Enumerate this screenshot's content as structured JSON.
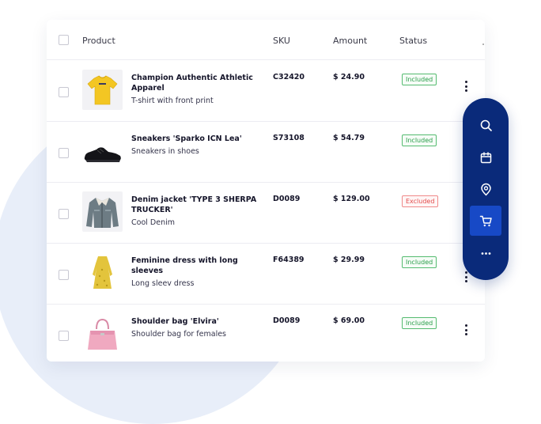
{
  "table": {
    "headers": {
      "product": "Product",
      "sku": "SKU",
      "amount": "Amount",
      "status": "Status"
    },
    "rows": [
      {
        "name": "Champion Authentic Athletic Apparel",
        "description": "T-shirt with front print",
        "sku": "C32420",
        "amount": "$ 24.90",
        "status": "Included",
        "image_icon": "tshirt-icon"
      },
      {
        "name": "Sneakers 'Sparko ICN Lea'",
        "description": "Sneakers in shoes",
        "sku": "S73108",
        "amount": "$ 54.79",
        "status": "Included",
        "image_icon": "sneaker-icon"
      },
      {
        "name": "Denim jacket 'TYPE 3 SHERPA TRUCKER'",
        "description": "Cool Denim",
        "sku": "D0089",
        "amount": "$ 129.00",
        "status": "Excluded",
        "image_icon": "jacket-icon"
      },
      {
        "name": "Feminine dress with long sleeves",
        "description": "Long sleev dress",
        "sku": "F64389",
        "amount": "$ 29.99",
        "status": "Included",
        "image_icon": "dress-icon"
      },
      {
        "name": "Shoulder bag 'Elvira'",
        "description": "Shoulder bag for females",
        "sku": "D0089",
        "amount": "$ 69.00",
        "status": "Included",
        "image_icon": "bag-icon"
      }
    ]
  },
  "floating_toolbar": {
    "items": [
      "search-icon",
      "calendar-icon",
      "location-pin-icon",
      "cart-icon",
      "more-horizontal-icon"
    ],
    "active": "cart-icon"
  },
  "colors": {
    "toolbar_bg": "#0a2a7a",
    "toolbar_active": "#1749c6",
    "included": "#2a9e4a",
    "excluded": "#e14b4b",
    "background_circle": "#e8eef9"
  }
}
